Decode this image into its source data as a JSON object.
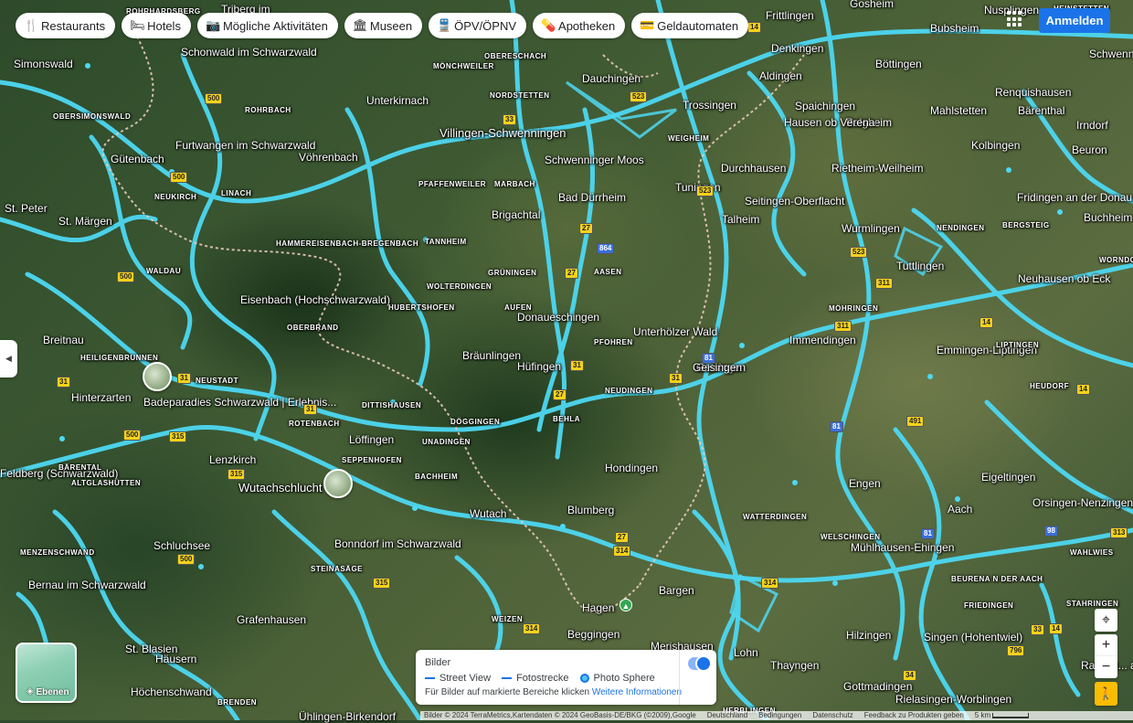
{
  "chips": [
    {
      "icon": "fork-knife-icon",
      "glyph": "🍴",
      "label": "Restaurants"
    },
    {
      "icon": "bed-icon",
      "glyph": "🛏",
      "label": "Hotels"
    },
    {
      "icon": "camera-icon",
      "glyph": "📷",
      "label": "Mögliche Aktivitäten"
    },
    {
      "icon": "museum-icon",
      "glyph": "🏛",
      "label": "Museen"
    },
    {
      "icon": "transit-icon",
      "glyph": "🚆",
      "label": "ÖPV/ÖPNV"
    },
    {
      "icon": "pharmacy-icon",
      "glyph": "💊",
      "label": "Apotheken"
    },
    {
      "icon": "atm-icon",
      "glyph": "💳",
      "label": "Geldautomaten"
    }
  ],
  "header": {
    "signin_label": "Anmelden"
  },
  "places": [
    {
      "name": "Villingen-Schwenningen"
    },
    {
      "name": "Schwenninger Moos"
    },
    {
      "name": "Bad Dürrheim"
    },
    {
      "name": "Trossingen"
    },
    {
      "name": "Dauchingen"
    },
    {
      "name": "Tuningen"
    },
    {
      "name": "Donaueschingen"
    },
    {
      "name": "Hüfingen"
    },
    {
      "name": "Bräunlingen"
    },
    {
      "name": "Unterhölzer Wald"
    },
    {
      "name": "Geisingen"
    },
    {
      "name": "Immendingen"
    },
    {
      "name": "Tuttlingen"
    },
    {
      "name": "Spaichingen"
    },
    {
      "name": "Aldingen"
    },
    {
      "name": "Denkingen"
    },
    {
      "name": "Frittlingen"
    },
    {
      "name": "Gosheim"
    },
    {
      "name": "Bubsheim"
    },
    {
      "name": "Böttingen"
    },
    {
      "name": "Balgheim"
    },
    {
      "name": "Hausen ob Verena"
    },
    {
      "name": "Durchhausen"
    },
    {
      "name": "Seitingen-Oberflacht"
    },
    {
      "name": "Rietheim-Weilheim"
    },
    {
      "name": "Wurmlingen"
    },
    {
      "name": "Talheim"
    },
    {
      "name": "Brigachtal"
    },
    {
      "name": "Furtwangen im Schwarzwald"
    },
    {
      "name": "Gütenbach"
    },
    {
      "name": "Vöhrenbach"
    },
    {
      "name": "Unterkirnach"
    },
    {
      "name": "Schonwald im Schwarzwald"
    },
    {
      "name": "Simonswald"
    },
    {
      "name": "Triberg im"
    },
    {
      "name": "St. Märgen"
    },
    {
      "name": "Eisenbach (Hochschwarzwald)"
    },
    {
      "name": "Breitnau"
    },
    {
      "name": "Hinterzarten"
    },
    {
      "name": "Badeparadies Schwarzwald | Erlebnis..."
    },
    {
      "name": "Löffingen"
    },
    {
      "name": "Lenzkirch"
    },
    {
      "name": "Wutachschlucht"
    },
    {
      "name": "Wutach"
    },
    {
      "name": "Bonndorf im Schwarzwald"
    },
    {
      "name": "Schluchsee"
    },
    {
      "name": "Bernau im Schwarzwald"
    },
    {
      "name": "Grafenhausen"
    },
    {
      "name": "St. Blasien"
    },
    {
      "name": "Häusern"
    },
    {
      "name": "Höchenschwand"
    },
    {
      "name": "Ühlingen-Birkendorf"
    },
    {
      "name": "Blumberg"
    },
    {
      "name": "Hondingen"
    },
    {
      "name": "Bargen"
    },
    {
      "name": "Hagen"
    },
    {
      "name": "Beggingen"
    },
    {
      "name": "Merishausen"
    },
    {
      "name": "Engen"
    },
    {
      "name": "Aach"
    },
    {
      "name": "Eigeltingen"
    },
    {
      "name": "Orsingen-Nenzingen"
    },
    {
      "name": "Mühlhausen-Ehingen"
    },
    {
      "name": "Singen (Hohentwiel)"
    },
    {
      "name": "Hilzingen"
    },
    {
      "name": "Gottmadingen"
    },
    {
      "name": "Rielasingen-Worblingen"
    },
    {
      "name": "Thayngen"
    },
    {
      "name": "Lohn"
    },
    {
      "name": "Emmingen-Liptingen"
    },
    {
      "name": "Neuhausen ob Eck"
    },
    {
      "name": "Fridingen an der Donau"
    },
    {
      "name": "Buchheim"
    },
    {
      "name": "Kolbingen"
    },
    {
      "name": "Renquishausen"
    },
    {
      "name": "Mahlstetten"
    },
    {
      "name": "Bärenthal"
    },
    {
      "name": "Irndorf"
    },
    {
      "name": "Beuron"
    },
    {
      "name": "Nusplingen"
    },
    {
      "name": "Schwenn..."
    },
    {
      "name": "Radolfz... am Bode..."
    },
    {
      "name": "Feldberg (Schwarzwald)"
    },
    {
      "name": "St. Peter"
    },
    {
      "name": "Geisingen"
    }
  ],
  "small_places": [
    "ROHRHARDSBERG",
    "OBERSIMONSWALD",
    "NEUKIRCH",
    "LINACH",
    "ROHRBACH",
    "PFAFFENWEILER",
    "MARBACH",
    "NORDSTETTEN",
    "OBERESCHACH",
    "MÖNCHWEILER",
    "WEIGHEIM",
    "HAMMEREISENBACH-BREGENBACH",
    "TANNHEIM",
    "WOLTERDINGEN",
    "GRÜNINGEN",
    "AASEN",
    "HUBERTSHOFEN",
    "OBERBRAND",
    "AUFEN",
    "PFOHREN",
    "NEUDINGEN",
    "HEILIGENBRUNNEN",
    "NEUSTADT",
    "WALDAU",
    "ROTENBACH",
    "DITTISHAUSEN",
    "DÖGGINGEN",
    "BEHLA",
    "UNADINGEN",
    "SEPPENHOFEN",
    "BACHHEIM",
    "BÄRENTAL",
    "ALTGLASHÜTTEN",
    "MENZENSCHWAND",
    "STEINASÄGE",
    "WEIZEN",
    "BRENDEN",
    "WATTERDINGEN",
    "WELSCHINGEN",
    "NENDINGEN",
    "BERGSTEIG",
    "MÖHRINGEN",
    "LIPTINGEN",
    "HEUDORF",
    "WAHLWIES",
    "FRIEDINGEN",
    "BEURENA N DER AACH",
    "STAHRINGEN",
    "HEINSTETTEN",
    "WORNDORF",
    "HERBLINGEN"
  ],
  "road_shields": [
    "500",
    "33",
    "523",
    "27",
    "31",
    "311",
    "14",
    "315",
    "314",
    "81",
    "491",
    "98",
    "313",
    "34",
    "796",
    "864"
  ],
  "controls": {
    "layers_label": "Ebenen",
    "zoom_in": "+",
    "zoom_out": "−"
  },
  "legend": {
    "title": "Bilder",
    "items": [
      "Street View",
      "Fotostrecke",
      "Photo Sphere"
    ],
    "footer_text": "Für Bilder auf markierte Bereiche klicken",
    "footer_link": "Weitere Informationen",
    "toggle_on": true
  },
  "footer": {
    "attribution": "Bilder © 2024 TerraMetrics,Kartendaten © 2024 GeoBasis-DE/BKG (©2009),Google",
    "country": "Deutschland",
    "terms": "Bedingungen",
    "privacy": "Datenschutz",
    "feedback": "Feedback zu Produkten geben",
    "scale": "5 km"
  },
  "colors": {
    "road_highlight": "#4dd8f2",
    "border": "#e8c9b8",
    "signin": "#1a73e8"
  }
}
